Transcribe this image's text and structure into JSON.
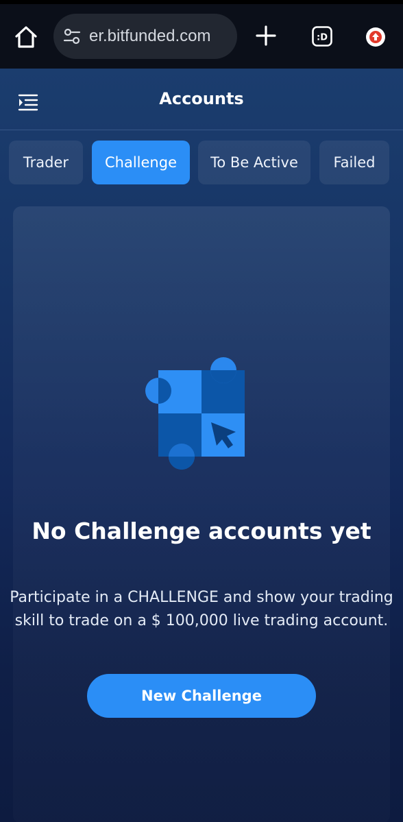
{
  "browser": {
    "url": "er.bitfunded.com",
    "tab_count_label": ":D",
    "icons": [
      "home-icon",
      "site-settings-icon",
      "plus-icon",
      "tabs-icon",
      "extension-icon"
    ]
  },
  "header": {
    "title": "Accounts",
    "menu_icon": "menu-collapse-icon"
  },
  "tabs": [
    {
      "label": "Trader",
      "active": false
    },
    {
      "label": "Challenge",
      "active": true
    },
    {
      "label": "To Be Active",
      "active": false
    },
    {
      "label": "Failed",
      "active": false
    }
  ],
  "empty_state": {
    "illustration": "checkerboard-cursor-illustration",
    "title": "No Challenge accounts yet",
    "description": "Participate in a CHALLENGE and show your trading skill to trade on a $ 100,000 live trading account.",
    "button_label": "New Challenge"
  },
  "colors": {
    "accent": "#2b8ef6",
    "background_top": "#1b3d6e",
    "background_bottom": "#0d1b40",
    "browser_bar": "#0b0f19"
  }
}
